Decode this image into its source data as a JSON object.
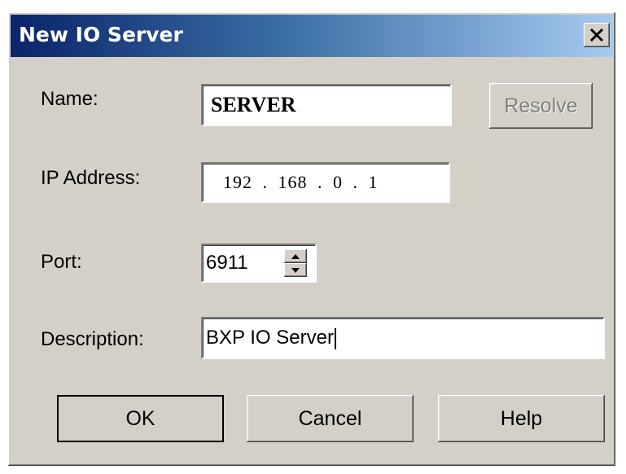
{
  "dialog": {
    "title": "New IO Server",
    "close_glyph": "✕"
  },
  "fields": {
    "name": {
      "label": "Name:",
      "value": "SERVER"
    },
    "ip": {
      "label": "IP Address:",
      "octets": [
        "192",
        "168",
        "0",
        "1"
      ],
      "separator": "."
    },
    "port": {
      "label": "Port:",
      "value": "6911"
    },
    "description": {
      "label": "Description:",
      "value": "BXP IO Server"
    }
  },
  "buttons": {
    "resolve": "Resolve",
    "ok": "OK",
    "cancel": "Cancel",
    "help": "Help"
  },
  "icons": {
    "close": "close-icon",
    "spin_up": "spin-up-icon",
    "spin_down": "spin-down-icon"
  },
  "colors": {
    "title_start": "#0a246a",
    "title_end": "#a6caf0",
    "face": "#d4d0c8"
  }
}
